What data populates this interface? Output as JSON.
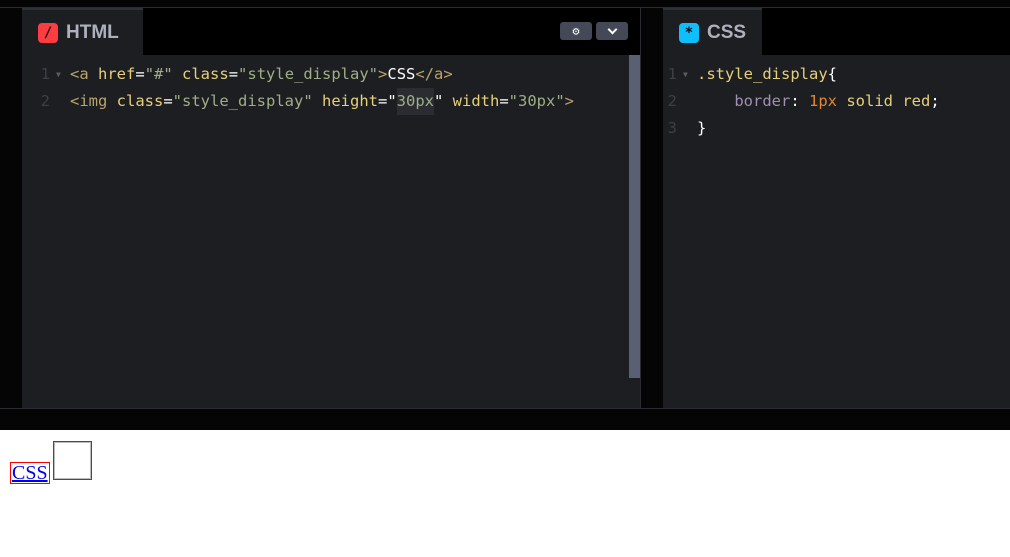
{
  "html_panel": {
    "tab_label": "HTML",
    "icon": "/",
    "icon_color": "#ff3c41",
    "lines": [
      {
        "n": "1",
        "parts": [
          "<a",
          " href",
          "=",
          "\"#\"",
          " class",
          "=",
          "\"style_display\"",
          ">",
          "CSS",
          "</a>"
        ]
      },
      {
        "n": "2",
        "parts": [
          "<img",
          " class",
          "=",
          "\"style_display\"",
          " height",
          "=\"",
          "30px",
          "\"",
          " width",
          "=",
          "\"30px\"",
          ">"
        ]
      }
    ]
  },
  "css_panel": {
    "tab_label": "CSS",
    "icon": "*",
    "icon_color": "#0ebeff",
    "lines": [
      {
        "n": "1",
        "parts": [
          ".style_display",
          "{"
        ]
      },
      {
        "n": "2",
        "parts": [
          "border",
          ":",
          " 1px",
          " solid red",
          ";"
        ]
      },
      {
        "n": "3",
        "parts": [
          "}"
        ]
      }
    ]
  },
  "preview": {
    "link_text": "CSS"
  }
}
